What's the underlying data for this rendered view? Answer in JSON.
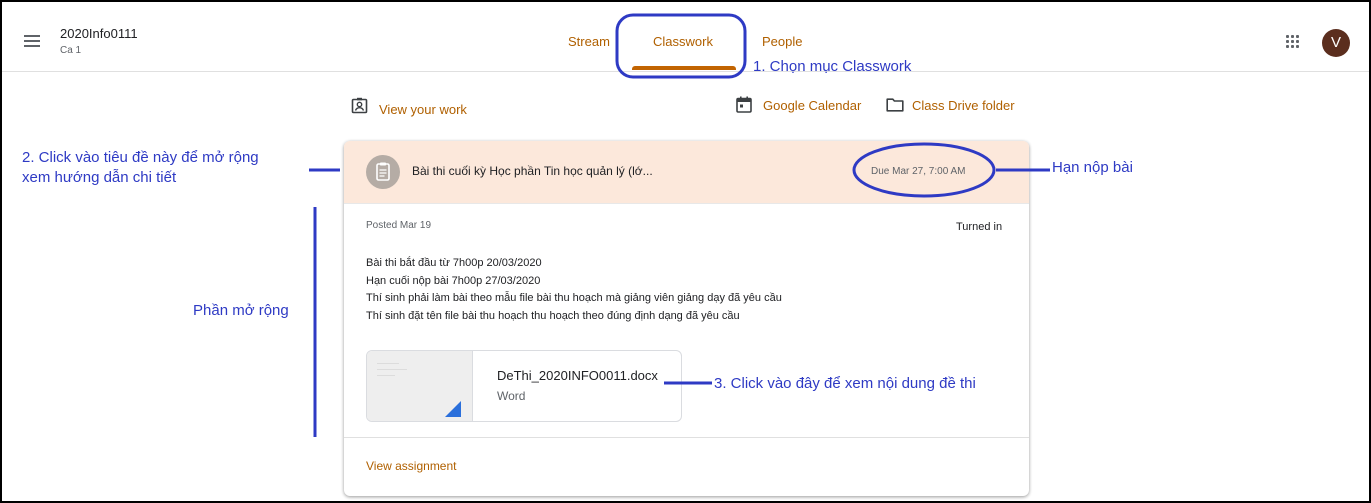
{
  "header": {
    "class_name": "2020Info0111",
    "class_section": "Ca 1",
    "tabs": [
      {
        "label": "Stream"
      },
      {
        "label": "Classwork"
      },
      {
        "label": "People"
      }
    ],
    "avatar_letter": "V",
    "icons": [
      "menu-icon",
      "apps-icon"
    ]
  },
  "toolbar": {
    "view_work": "View your work",
    "calendar": "Google Calendar",
    "drive": "Class Drive folder"
  },
  "assignment": {
    "title": "Bài thi cuối kỳ Học phần Tin học quản lý (lớ...",
    "due": "Due Mar 27, 7:00 AM",
    "posted": "Posted Mar 19",
    "status": "Turned in",
    "description": [
      "Bài thi bắt đầu từ 7h00p 20/03/2020",
      "Hạn cuối nộp bài 7h00p 27/03/2020",
      "Thí sinh phải làm bài theo mẫu file bài thu hoạch mà giảng viên giảng dạy đã yêu cầu",
      "Thí sinh đặt tên file bài thu hoạch thu hoạch theo đúng định dạng đã yêu cầu"
    ],
    "attachment": {
      "name": "DeThi_2020INFO0011.docx",
      "type": "Word"
    },
    "view_link": "View assignment"
  },
  "annotations": {
    "step1": "1. Chọn mục Classwork",
    "step2_line1": "2. Click vào tiêu đề này để mở rộng",
    "step2_line2": "xem hướng dẫn chi tiết",
    "deadline": "Hạn nộp bài",
    "expanded": "Phần mở rộng",
    "step3": "3. Click vào đây để xem nội dung đề thi"
  },
  "colors": {
    "accent": "#b06000",
    "annotation": "#2e3ac4",
    "header_band": "#fce8db"
  }
}
